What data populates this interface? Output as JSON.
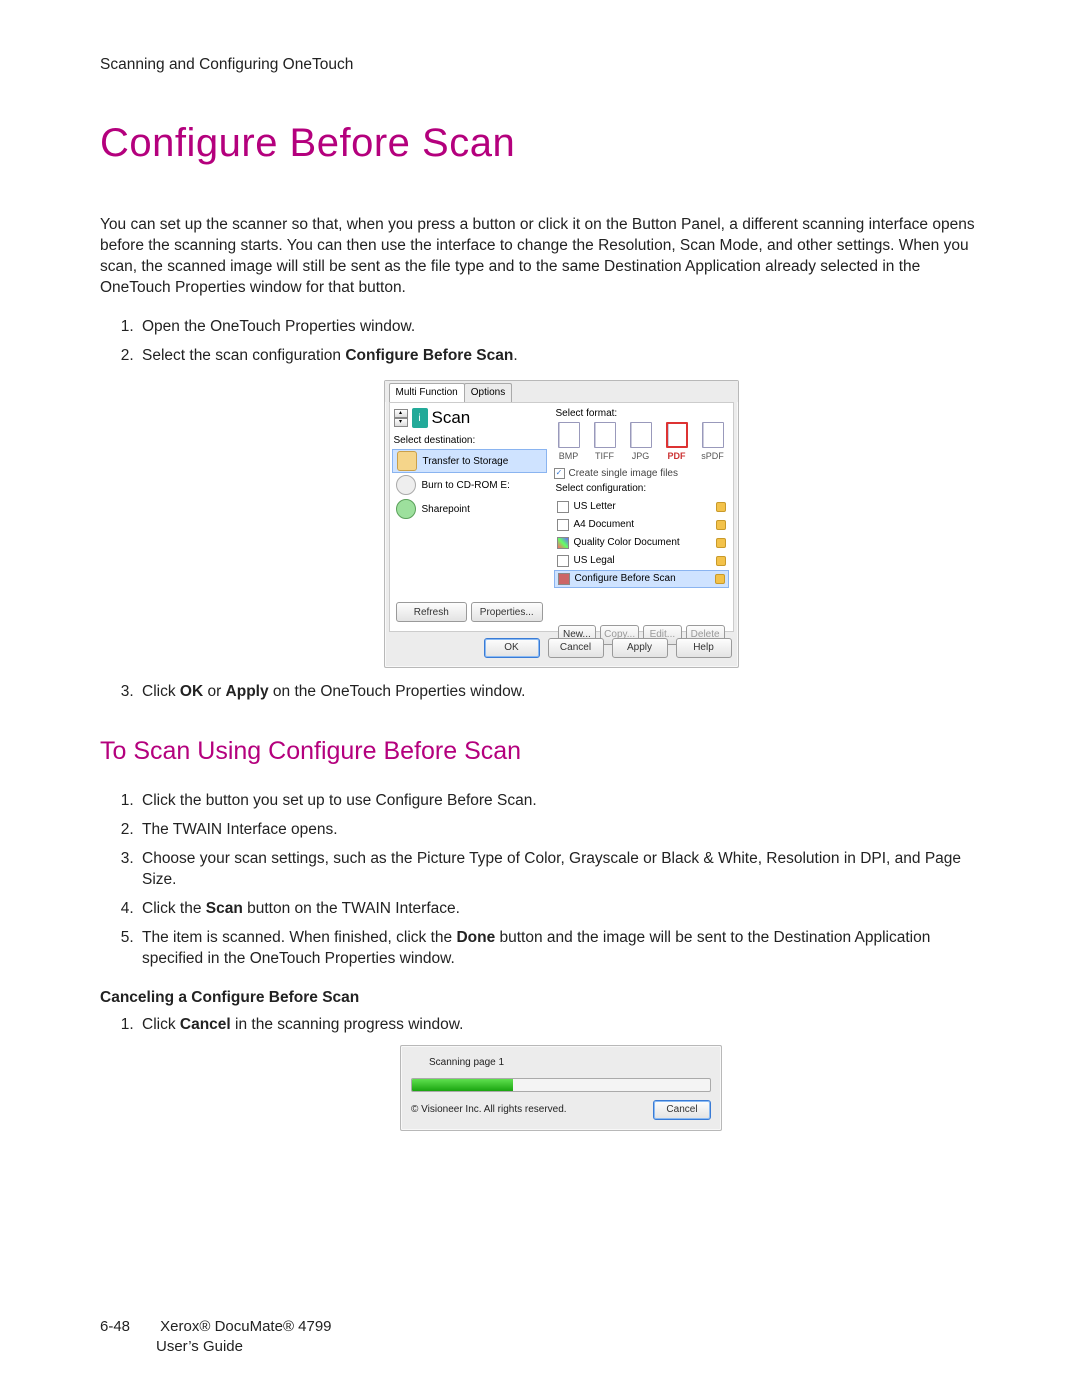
{
  "header": "Scanning and Configuring OneTouch",
  "title": "Configure Before Scan",
  "intro": "You can set up the scanner so that, when you press a button or click it on the Button Panel, a different scanning interface opens before the scanning starts. You can then use the interface to change the Resolution, Scan Mode, and other settings. When you scan, the scanned image will still be sent as the file type and to the same Destination Application already selected in the OneTouch Properties window for that button.",
  "steps1": {
    "s1": "Open the OneTouch Properties window.",
    "s2a": "Select the scan configuration ",
    "s2b": "Configure Before Scan",
    "s2c": ".",
    "s3a": "Click ",
    "s3b": "OK",
    "s3c": " or ",
    "s3d": "Apply",
    "s3e": " on the OneTouch Properties window."
  },
  "subheading": "To Scan Using Configure Before Scan",
  "steps2": {
    "s1": "Click the button you set up to use Configure Before Scan.",
    "s2": "The TWAIN Interface opens.",
    "s3": "Choose your scan settings, such as the Picture Type of Color, Grayscale or Black & White, Resolution in DPI, and Page Size.",
    "s4a": "Click the ",
    "s4b": "Scan",
    "s4c": " button on the TWAIN Interface.",
    "s5a": "The item is scanned. When finished, click the ",
    "s5b": "Done",
    "s5c": " button and the image will be sent to the Destination Application specified in the OneTouch Properties window."
  },
  "cancel_heading": "Canceling a Configure Before Scan",
  "cancel_step_a": "Click ",
  "cancel_step_b": "Cancel",
  "cancel_step_c": " in the scanning progress window.",
  "dialog1": {
    "tabs": {
      "t0": "Multi Function",
      "t1": "Options"
    },
    "scan_label": "Scan",
    "dest_label": "Select destination:",
    "destinations": {
      "d0": "Transfer to Storage",
      "d1": "Burn to CD-ROM  E:",
      "d2": "Sharepoint"
    },
    "format_label": "Select format:",
    "formats": {
      "f0": "BMP",
      "f1": "TIFF",
      "f2": "JPG",
      "f3": "PDF",
      "f4": "sPDF"
    },
    "checkbox": "Create single image files",
    "config_label": "Select configuration:",
    "configs": {
      "c0": "US Letter",
      "c1": "A4 Document",
      "c2": "Quality Color Document",
      "c3": "US Legal",
      "c4": "Configure Before Scan"
    },
    "buttons": {
      "refresh": "Refresh",
      "properties": "Properties...",
      "new": "New...",
      "copy": "Copy...",
      "edit": "Edit...",
      "delete": "Delete",
      "ok": "OK",
      "cancel": "Cancel",
      "apply": "Apply",
      "help": "Help"
    }
  },
  "dialog2": {
    "status": "Scanning page 1",
    "copyright": "© Visioneer Inc. All rights reserved.",
    "cancel": "Cancel"
  },
  "footer": {
    "page": "6-48",
    "line1": "Xerox® DocuMate® 4799",
    "line2": "User’s Guide"
  }
}
